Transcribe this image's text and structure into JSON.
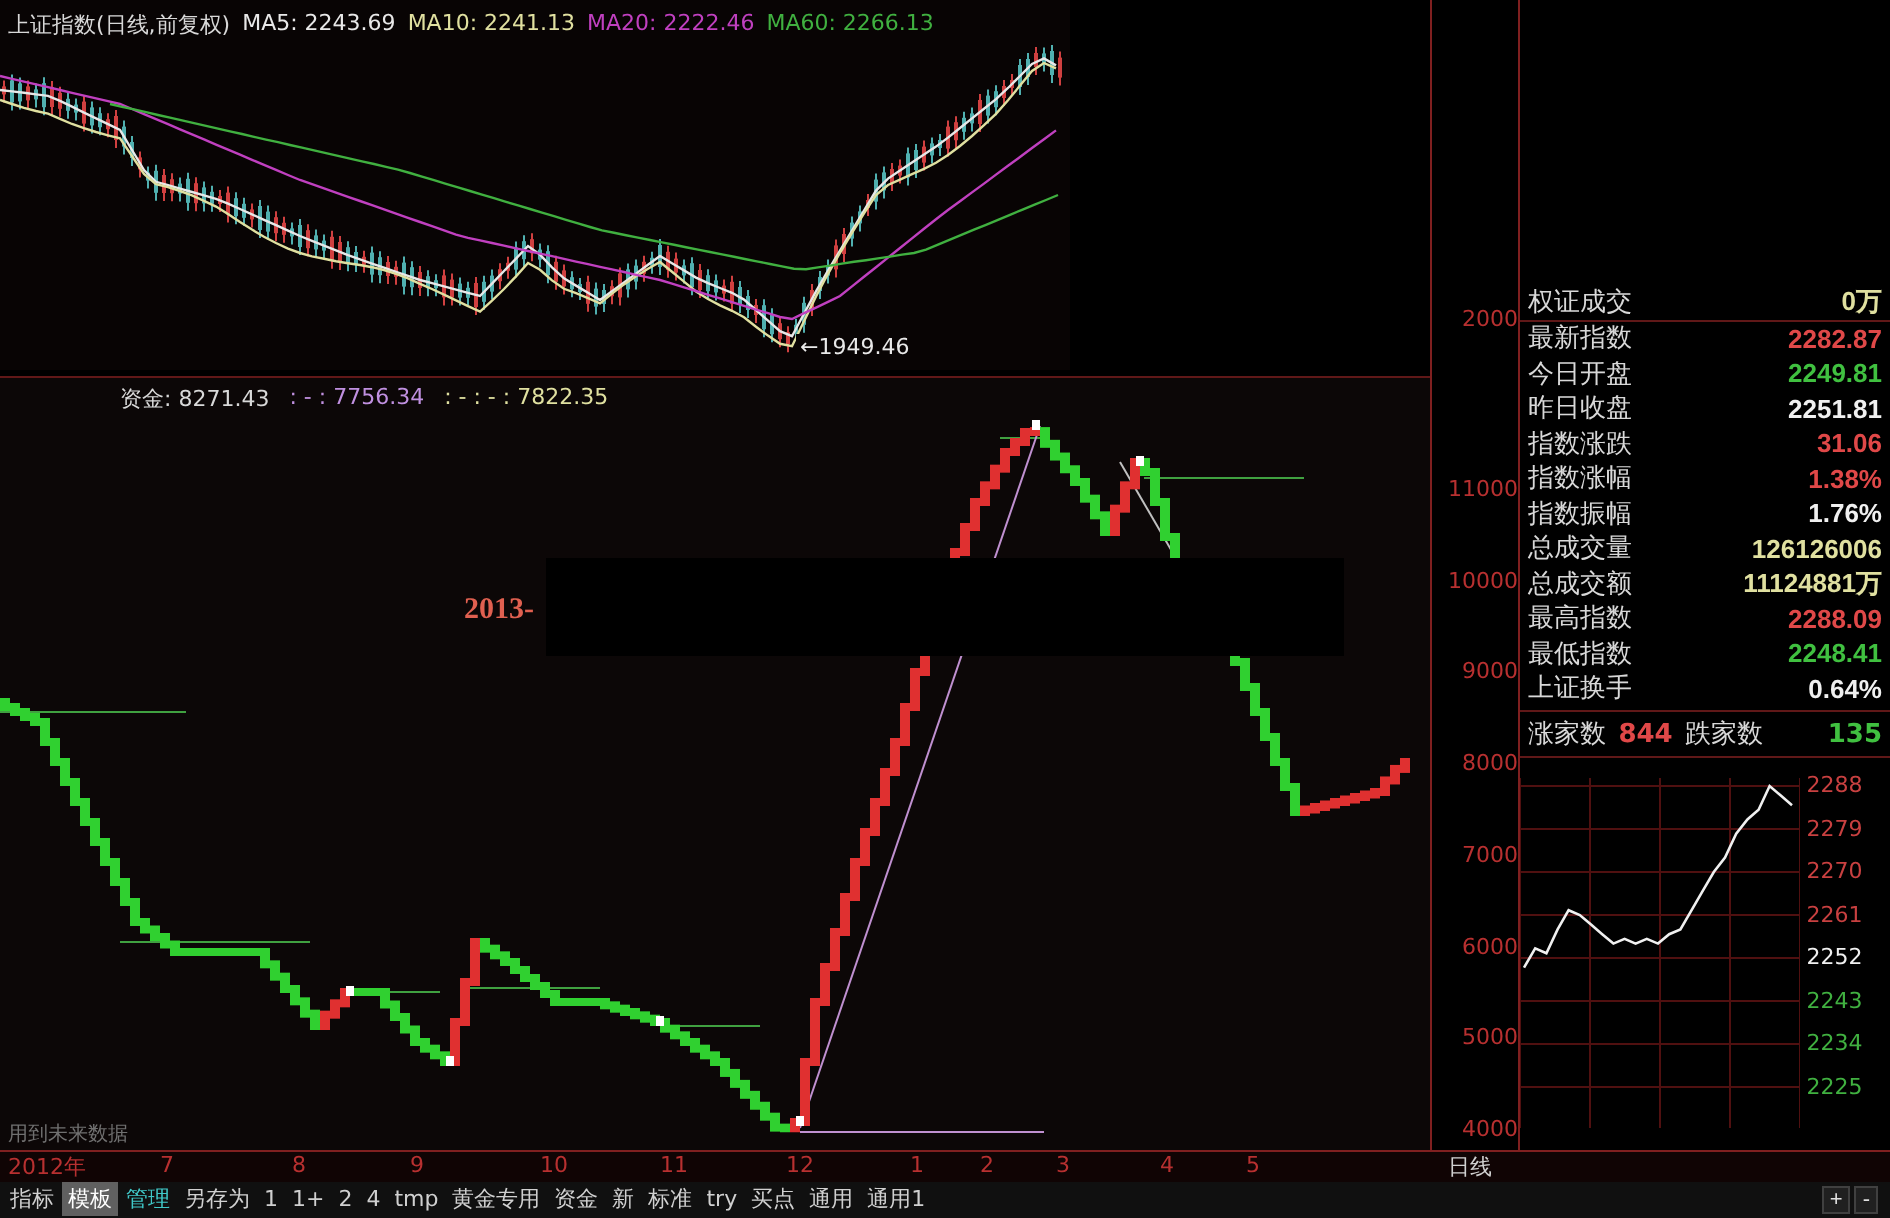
{
  "top_chart": {
    "title": "上证指数(日线,前复权)",
    "legend": [
      {
        "label": "MA5: 2243.69",
        "color": "#e8e8e8"
      },
      {
        "label": "MA10: 2241.13",
        "color": "#e0e0a0"
      },
      {
        "label": "MA20: 2222.46",
        "color": "#c040c0"
      },
      {
        "label": "MA60: 2266.13",
        "color": "#40b040"
      }
    ],
    "low_marker": "←1949.46",
    "axis_label": "2000"
  },
  "indicator_chart": {
    "legend": [
      {
        "label": "资金: 8271.43",
        "color": "#d8d8d8"
      },
      {
        "label": ": - : 7756.34",
        "color": "#c090e0"
      },
      {
        "label": ": - : - : 7822.35",
        "color": "#e0e0a0"
      }
    ],
    "date_label": "2013-",
    "note": "用到未来数据",
    "y_ticks": [
      "11000",
      "10000",
      "9000",
      "8000",
      "7000",
      "6000",
      "5000",
      "4000"
    ]
  },
  "x_axis": {
    "labels": [
      "2012年",
      "7",
      "8",
      "9",
      "10",
      "11",
      "12",
      "1",
      "2",
      "3",
      "4",
      "5"
    ],
    "period": "日线"
  },
  "quote_panel": {
    "rows": [
      {
        "label": "权证成交",
        "value": "0万",
        "color": "#e0e0a0"
      },
      {
        "label": "最新指数",
        "value": "2282.87",
        "color": "#e04848"
      },
      {
        "label": "今日开盘",
        "value": "2249.81",
        "color": "#40c040"
      },
      {
        "label": "昨日收盘",
        "value": "2251.81",
        "color": "#f0f0f0"
      },
      {
        "label": "指数涨跌",
        "value": "31.06",
        "color": "#e04848"
      },
      {
        "label": "指数涨幅",
        "value": "1.38%",
        "color": "#e04848"
      },
      {
        "label": "指数振幅",
        "value": "1.76%",
        "color": "#f0f0f0"
      },
      {
        "label": "总成交量",
        "value": "126126006",
        "color": "#e0e0a0"
      },
      {
        "label": "总成交额",
        "value": "11124881万",
        "color": "#e0e0a0"
      },
      {
        "label": "最高指数",
        "value": "2288.09",
        "color": "#e04848"
      },
      {
        "label": "最低指数",
        "value": "2248.41",
        "color": "#40c040"
      },
      {
        "label": "上证换手",
        "value": "0.64%",
        "color": "#f0f0f0"
      }
    ],
    "breadth": {
      "up_label": "涨家数",
      "up_value": "844",
      "down_label": "跌家数",
      "down_value": "135"
    }
  },
  "intraday_chart": {
    "chart_data": {
      "type": "line",
      "ylim": [
        2225,
        2288
      ],
      "grid": true,
      "yticks": [
        {
          "value": 2288,
          "label": "2288"
        },
        {
          "value": 2279,
          "label": "2279"
        },
        {
          "value": 2270,
          "label": "2270"
        },
        {
          "value": 2261,
          "label": "2261"
        },
        {
          "value": 2252,
          "label": "2252"
        },
        {
          "value": 2243,
          "label": "2243"
        },
        {
          "value": 2234,
          "label": "2234"
        },
        {
          "value": 2225,
          "label": "2225"
        }
      ],
      "series": [
        {
          "color": "#f0f0f0",
          "values": [
            2250,
            2254,
            2253,
            2258,
            2262,
            2261,
            2259,
            2257,
            2255,
            2256,
            2255,
            2256,
            2255,
            2257,
            2258,
            2262,
            2266,
            2270,
            2273,
            2278,
            2281,
            2283,
            2288,
            2286,
            2284
          ]
        }
      ]
    }
  },
  "toolbar": {
    "items": [
      {
        "label": "指标",
        "selected": false,
        "highlighted": false
      },
      {
        "label": "模板",
        "selected": false,
        "highlighted": true
      },
      {
        "label": "管理",
        "selected": true,
        "highlighted": false
      },
      {
        "label": "另存为",
        "selected": false,
        "highlighted": false
      },
      {
        "label": "1",
        "selected": false,
        "highlighted": false
      },
      {
        "label": "1+",
        "selected": false,
        "highlighted": false
      },
      {
        "label": "2",
        "selected": false,
        "highlighted": false
      },
      {
        "label": "4",
        "selected": false,
        "highlighted": false
      },
      {
        "label": "tmp",
        "selected": false,
        "highlighted": false
      },
      {
        "label": "黄金专用",
        "selected": false,
        "highlighted": false
      },
      {
        "label": "资金",
        "selected": false,
        "highlighted": false
      },
      {
        "label": "新",
        "selected": false,
        "highlighted": false
      },
      {
        "label": "标准",
        "selected": false,
        "highlighted": false
      },
      {
        "label": "try",
        "selected": false,
        "highlighted": false
      },
      {
        "label": "买点",
        "selected": false,
        "highlighted": false
      },
      {
        "label": "通用",
        "selected": false,
        "highlighted": false
      },
      {
        "label": "通用1",
        "selected": false,
        "highlighted": false
      }
    ],
    "zoom_in": "+",
    "zoom_out": "-"
  }
}
